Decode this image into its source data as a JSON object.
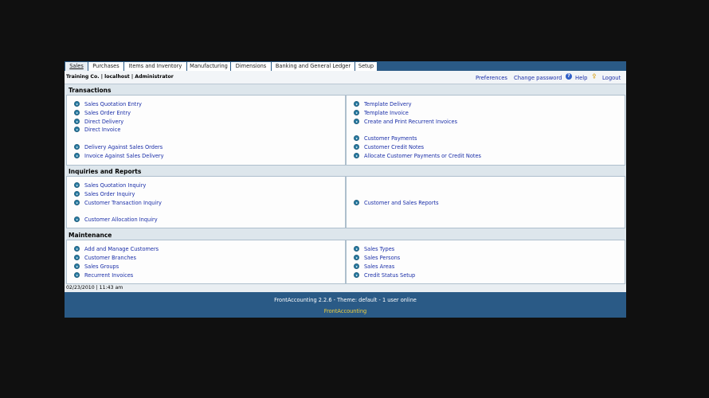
{
  "tabs": [
    "Sales",
    "Purchases",
    "Items and Inventory",
    "Manufacturing",
    "Dimensions",
    "Banking and General Ledger",
    "Setup"
  ],
  "user_info": "Training Co. | localhost | Administrator",
  "top_links": {
    "preferences": "Preferences",
    "change_password": "Change password",
    "help": "Help",
    "logout": "Logout"
  },
  "sections": {
    "transactions": {
      "title": "Transactions",
      "left": [
        "Sales Quotation Entry",
        "Sales Order Entry",
        "Direct Delivery",
        "Direct Invoice",
        "Delivery Against Sales Orders",
        "Invoice Against Sales Delivery"
      ],
      "right": [
        "Template Delivery",
        "Template Invoice",
        "Create and Print Recurrent Invoices",
        "Customer Payments",
        "Customer Credit Notes",
        "Allocate Customer Payments or Credit Notes"
      ]
    },
    "inquiries": {
      "title": "Inquiries and Reports",
      "left": [
        "Sales Quotation Inquiry",
        "Sales Order Inquiry",
        "Customer Transaction Inquiry",
        "Customer Allocation Inquiry"
      ],
      "right": [
        "Customer and Sales Reports"
      ]
    },
    "maintenance": {
      "title": "Maintenance",
      "left": [
        "Add and Manage Customers",
        "Customer Branches",
        "Sales Groups",
        "Recurrent Invoices"
      ],
      "right": [
        "Sales Types",
        "Sales Persons",
        "Sales Areas",
        "Credit Status Setup"
      ]
    }
  },
  "datetime": "02/23/2010 | 11:43 am",
  "footer": {
    "version": "FrontAccounting 2.2.6 - Theme: default - 1 user online",
    "brand": "FrontAccounting"
  },
  "colors": {
    "header_blue": "#2a5a86",
    "link_blue": "#1a2ea8",
    "footer_brand": "#f0ce3a"
  }
}
